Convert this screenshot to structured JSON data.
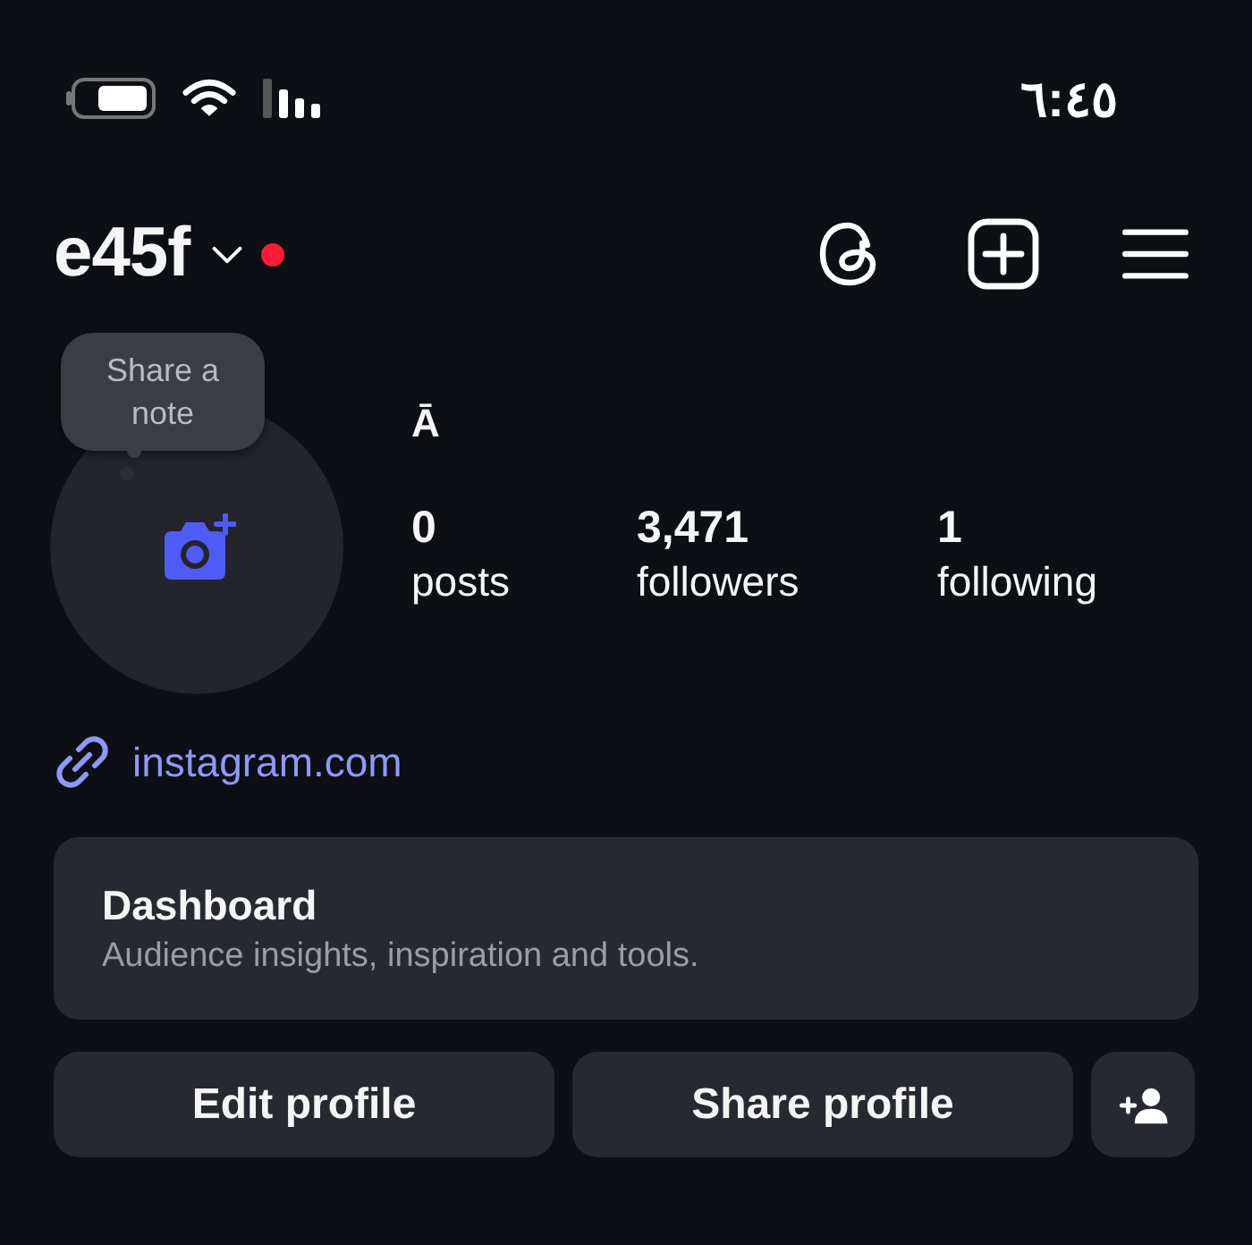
{
  "status_bar": {
    "time": "٦:٤٥"
  },
  "header": {
    "username": "e45f"
  },
  "profile": {
    "note": "Share a note",
    "name": "Ā",
    "stats": [
      {
        "value": "0",
        "label": "posts"
      },
      {
        "value": "3,471",
        "label": "followers"
      },
      {
        "value": "1",
        "label": "following"
      }
    ],
    "link": "instagram.com"
  },
  "dashboard": {
    "title": "Dashboard",
    "subtitle": "Audience insights, inspiration and tools."
  },
  "buttons": [
    "Edit profile",
    "Share profile"
  ]
}
